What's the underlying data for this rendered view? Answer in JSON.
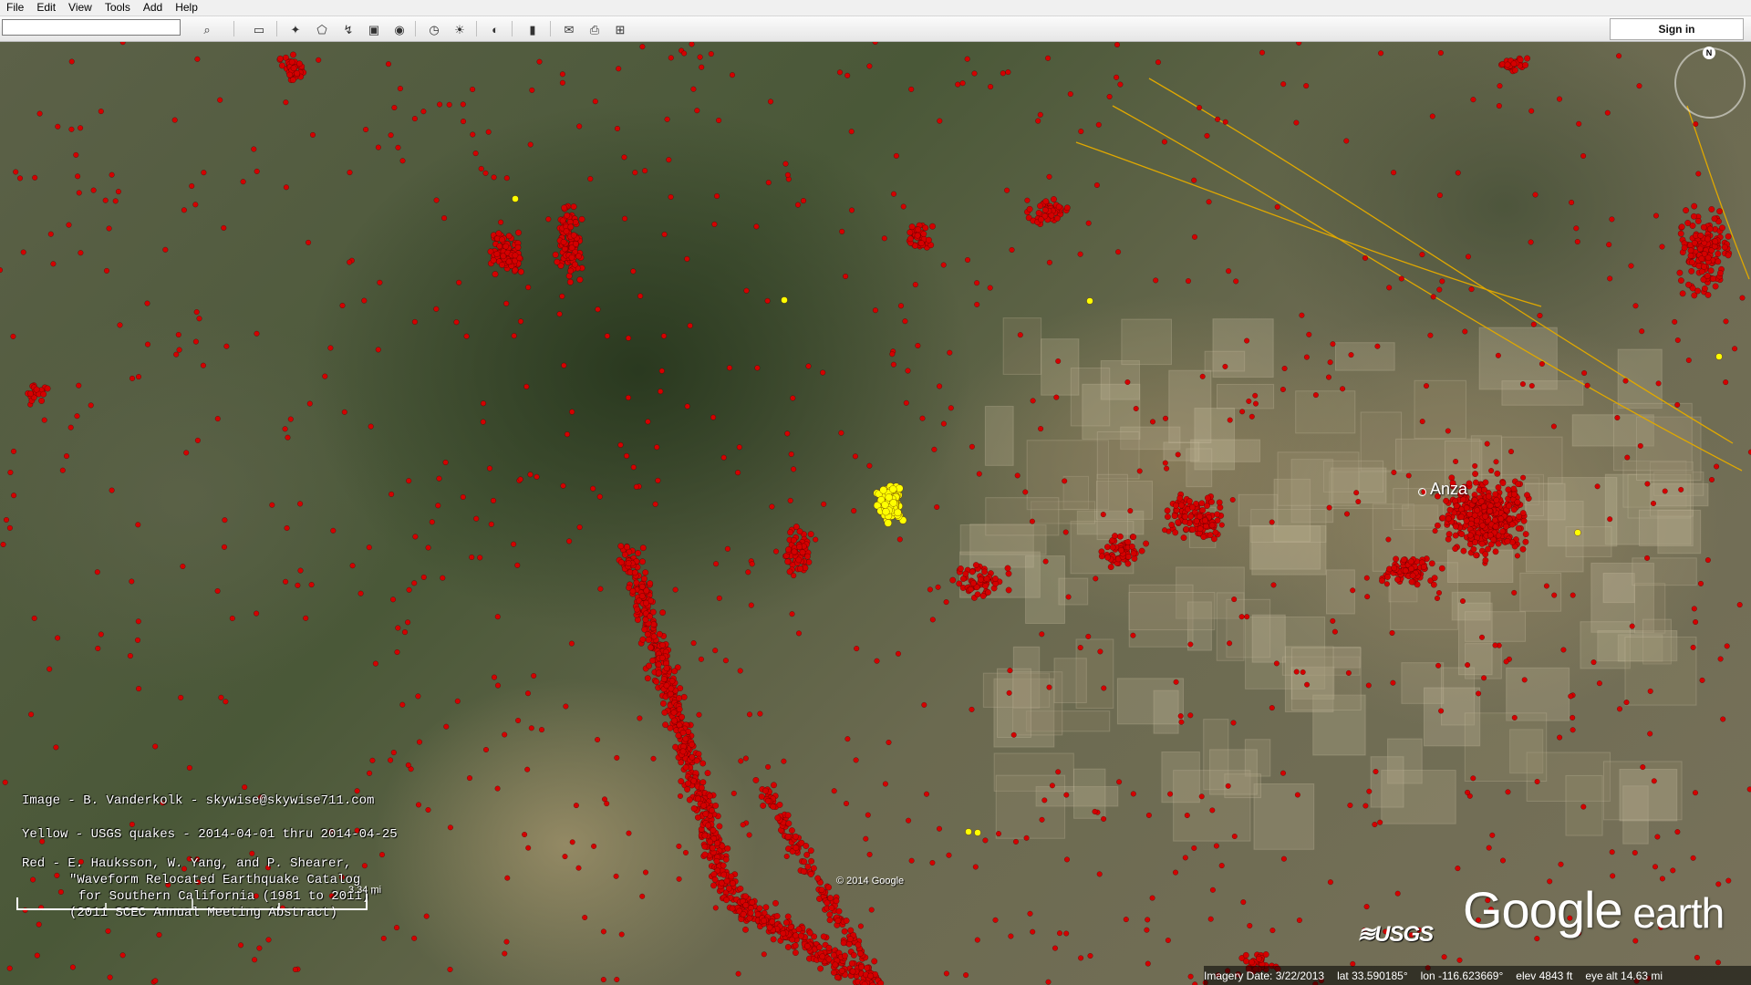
{
  "menu": [
    "File",
    "Edit",
    "View",
    "Tools",
    "Add",
    "Help"
  ],
  "toolbar": {
    "search_value": "",
    "buttons": [
      {
        "name": "search-icon",
        "glyph": "⌕"
      },
      {
        "name": "sidebar-toggle-icon",
        "glyph": "▭"
      },
      {
        "name": "placemark-icon",
        "glyph": "✦"
      },
      {
        "name": "polygon-icon",
        "glyph": "⬠"
      },
      {
        "name": "path-icon",
        "glyph": "↯"
      },
      {
        "name": "image-overlay-icon",
        "glyph": "▣"
      },
      {
        "name": "record-tour-icon",
        "glyph": "◉"
      },
      {
        "name": "historical-imagery-icon",
        "glyph": "◷"
      },
      {
        "name": "sunlight-icon",
        "glyph": "☀"
      },
      {
        "name": "planets-icon",
        "glyph": "◐"
      },
      {
        "name": "ruler-icon",
        "glyph": "▮"
      },
      {
        "name": "email-icon",
        "glyph": "✉"
      },
      {
        "name": "print-icon",
        "glyph": "⎙"
      },
      {
        "name": "view-in-maps-icon",
        "glyph": "⊞"
      }
    ],
    "sign_in_label": "Sign in"
  },
  "overlay": {
    "credit": "Image - B. Vanderkolk - skywise@skywise711.com",
    "yellow_note": "Yellow - USGS quakes - 2014-04-01 thru 2014-04-25",
    "red_note_1": "Red - E. Hauksson, W. Yang, and P. Shearer,",
    "red_note_2": "\"Waveform Relocated Earthquake Catalog",
    "red_note_3": "for Southern California (1981 to 2011)\"",
    "red_note_4": "(2011 SCEC Annual Meeting Abstract)"
  },
  "place_label": "Anza",
  "copyright": "© 2014 Google",
  "scale_label": "3.34 mi",
  "usgs_logo": "≋USGS",
  "logo": {
    "google": "Google",
    "earth": " earth"
  },
  "compass_label": "N",
  "status": {
    "imagery_date": "Imagery Date: 3/22/2013",
    "lat": "lat  33.590185°",
    "lon": "lon -116.623669°",
    "elev": "elev  4843 ft",
    "eye_alt": "eye alt  14.63 mi"
  },
  "colors": {
    "quake_red": "#d40000",
    "quake_yellow": "#ffff00",
    "fault_line": "#e0a800"
  }
}
